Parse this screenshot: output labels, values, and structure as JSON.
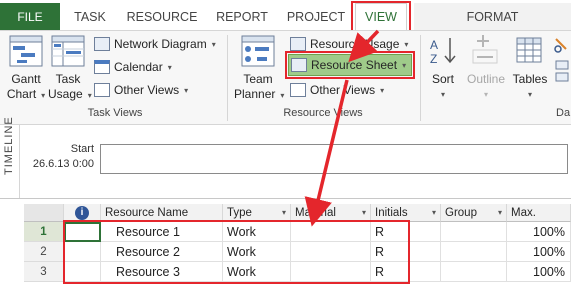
{
  "tabs": {
    "file": "FILE",
    "task": "TASK",
    "resource": "RESOURCE",
    "report": "REPORT",
    "project": "PROJECT",
    "view": "VIEW",
    "format": "FORMAT"
  },
  "ribbon": {
    "task_views": {
      "group_label": "Task Views",
      "gantt_chart": [
        "Gantt",
        "Chart"
      ],
      "task_usage": [
        "Task",
        "Usage"
      ],
      "network_diagram": "Network Diagram",
      "calendar": "Calendar",
      "other_views": "Other Views"
    },
    "resource_views": {
      "group_label": "Resource Views",
      "team_planner": [
        "Team",
        "Planner"
      ],
      "resource_usage": "Resource Usage",
      "resource_sheet": "Resource Sheet",
      "other_views": "Other Views"
    },
    "data": {
      "sort": "Sort",
      "outline": "Outline",
      "tables": "Tables",
      "group_label": "Da"
    }
  },
  "timeline": {
    "label": "TIMELINE",
    "start_label": "Start",
    "start_date": "26.6.13 0:00"
  },
  "grid": {
    "headers": {
      "info": "i",
      "resource_name": "Resource Name",
      "type": "Type",
      "material": "Material",
      "initials": "Initials",
      "group": "Group",
      "max": "Max."
    },
    "rows": [
      {
        "id": "1",
        "name": "Resource 1",
        "type": "Work",
        "material": "",
        "initials": "R",
        "group": "",
        "max": "100%"
      },
      {
        "id": "2",
        "name": "Resource 2",
        "type": "Work",
        "material": "",
        "initials": "R",
        "group": "",
        "max": "100%"
      },
      {
        "id": "3",
        "name": "Resource 3",
        "type": "Work",
        "material": "",
        "initials": "R",
        "group": "",
        "max": "100%"
      }
    ]
  },
  "colors": {
    "file_tab": "#2e7237",
    "highlight_red": "#e4262c",
    "resource_sheet_highlight": "#9fcb8a"
  }
}
